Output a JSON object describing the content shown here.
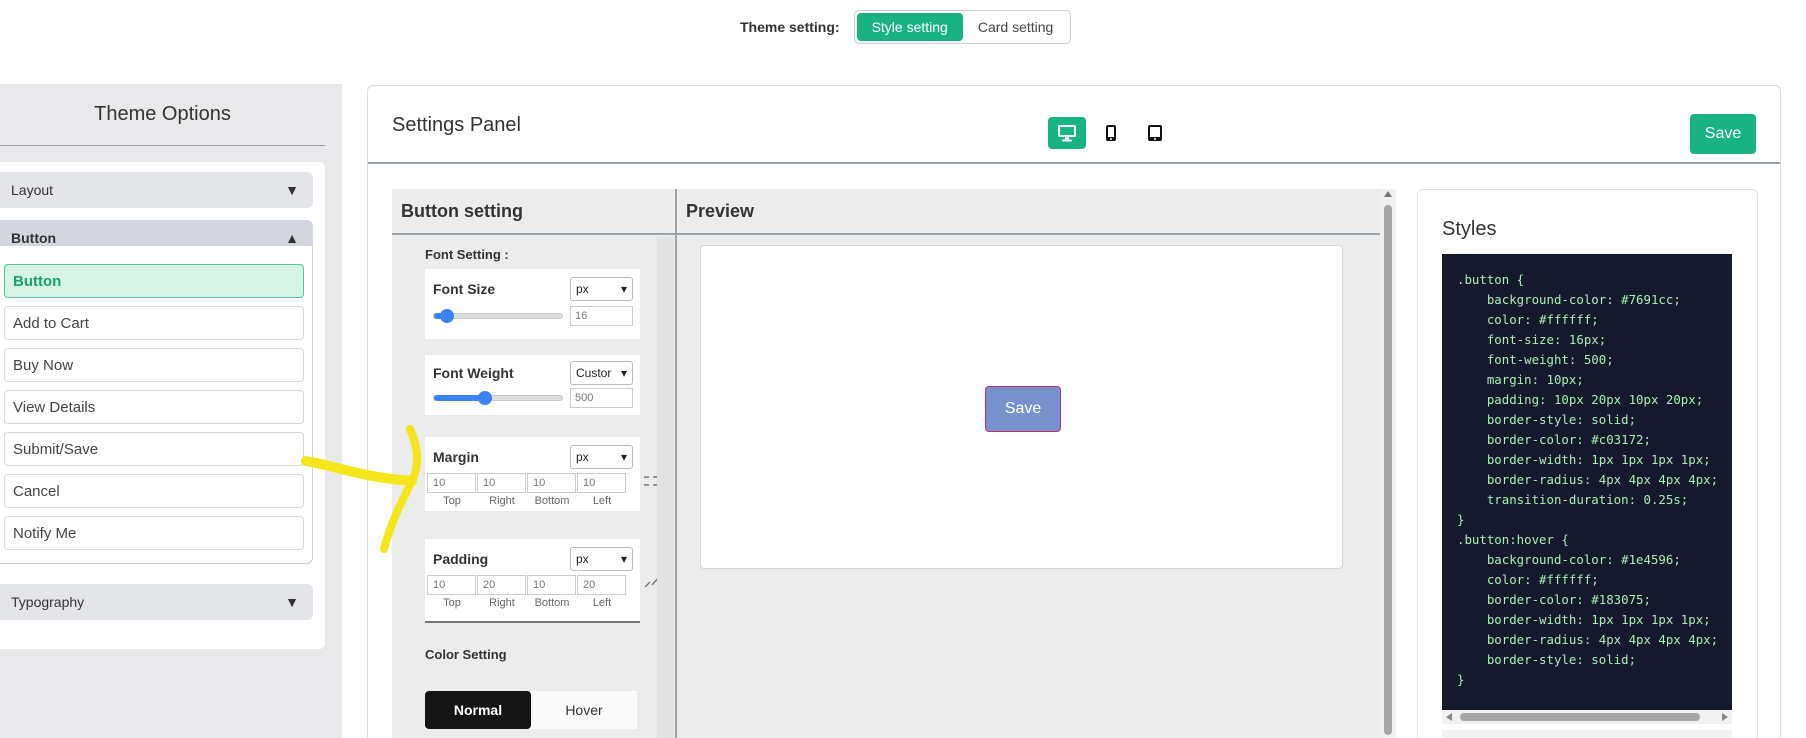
{
  "theme_setting": {
    "label": "Theme setting:",
    "tabs": [
      {
        "label": "Style setting",
        "active": true
      },
      {
        "label": "Card setting",
        "active": false
      }
    ]
  },
  "sidebar": {
    "title": "Theme Options",
    "sections": [
      {
        "label": "Layout",
        "arrow": "▼"
      },
      {
        "label": "Button",
        "arrow": "▲"
      },
      {
        "label": "Typography",
        "arrow": "▼"
      }
    ],
    "button_items": [
      "Button",
      "Add to Cart",
      "Buy Now",
      "View Details",
      "Submit/Save",
      "Cancel",
      "Notify Me"
    ]
  },
  "panel": {
    "title": "Settings Panel",
    "devices": [
      "desktop-icon",
      "mobile-icon",
      "tablet-icon"
    ],
    "save_label": "Save"
  },
  "button_setting": {
    "title": "Button setting",
    "font_setting_label": "Font Setting :",
    "font_size": {
      "label": "Font Size",
      "unit": "px",
      "value": "16",
      "level": 0.1
    },
    "font_weight": {
      "label": "Font Weight",
      "unit": "Custor",
      "value": "500",
      "level": 0.4
    },
    "margin": {
      "label": "Margin",
      "unit": "px",
      "values": [
        "10",
        "10",
        "10",
        "10"
      ],
      "captions": [
        "Top",
        "Right",
        "Bottom",
        "Left"
      ]
    },
    "padding": {
      "label": "Padding",
      "unit": "px",
      "values": [
        "10",
        "20",
        "10",
        "20"
      ],
      "captions": [
        "Top",
        "Right",
        "Bottom",
        "Left"
      ]
    },
    "color_setting_label": "Color Setting",
    "color_tabs": [
      {
        "label": "Normal",
        "active": true
      },
      {
        "label": "Hover",
        "active": false
      }
    ]
  },
  "preview": {
    "title": "Preview",
    "button_label": "Save",
    "button_bg": "#7691cc",
    "button_border": "#c03172"
  },
  "styles": {
    "title": "Styles",
    "code": ".button {\n    background-color: #7691cc;\n    color: #ffffff;\n    font-size: 16px;\n    font-weight: 500;\n    margin: 10px;\n    padding: 10px 20px 10px 20px;\n    border-style: solid;\n    border-color: #c03172;\n    border-width: 1px 1px 1px 1px;\n    border-radius: 4px 4px 4px 4px;\n    transition-duration: 0.25s;\n}\n.button:hover {\n    background-color: #1e4596;\n    color: #ffffff;\n    border-color: #183075;\n    border-width: 1px 1px 1px 1px;\n    border-radius: 4px 4px 4px 4px;\n    border-style: solid;\n}"
  },
  "colors": {
    "accent": "#19b383",
    "code_bg": "#141a2b",
    "code_text": "#a6f0b5",
    "annotation": "#f5e51b"
  }
}
